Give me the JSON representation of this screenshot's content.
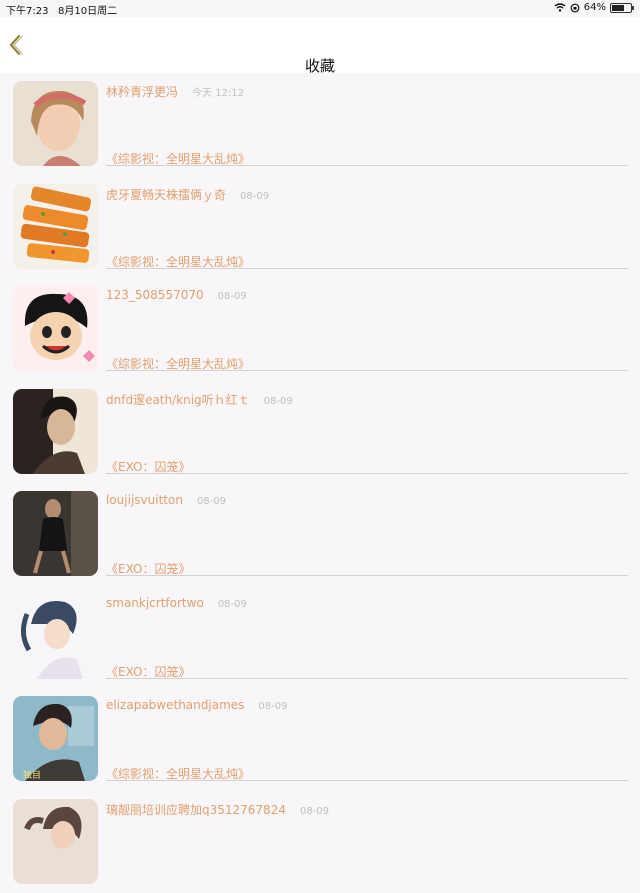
{
  "status": {
    "time": "下午7:23",
    "date": "8月10日周二",
    "battery": "64%",
    "battery_level": 0.64
  },
  "nav": {
    "title": "收藏",
    "back_icon": "chevron-left-icon",
    "back_color": "#8a7a2a"
  },
  "colors": {
    "accent": "#e0a070",
    "muted": "#c0c0c0",
    "background": "#f8f6f8"
  },
  "favorites": [
    {
      "name": "林矜青浮更冯",
      "date": "今天 12:12",
      "title": "《综影视：全明星大乱炖》",
      "avatar": "girl-photo"
    },
    {
      "name": "虎牙夏畅天株擂俩ｙ奇",
      "date": "08-09",
      "title": "《综影视：全明星大乱炖》",
      "avatar": "food-photo"
    },
    {
      "name": "123_508557070",
      "date": "08-09",
      "title": "《综影视：全明星大乱炖》",
      "avatar": "cartoon-photo"
    },
    {
      "name": "dnfd邃eath/knig听ｈ红ｔ",
      "date": "08-09",
      "title": "《EXO：囚笼》",
      "avatar": "man-photo"
    },
    {
      "name": "loujijsvuitton",
      "date": "08-09",
      "title": "《EXO：囚笼》",
      "avatar": "dark-photo"
    },
    {
      "name": "smankjcrtfortwo",
      "date": "08-09",
      "title": "《EXO：囚笼》",
      "avatar": "anime-photo"
    },
    {
      "name": "elizapabwethandjames",
      "date": "08-09",
      "title": "《综影视：全明星大乱炖》",
      "avatar": "boy-photo",
      "avatar_caption": "独目"
    },
    {
      "name": "璃靓丽培训应聘加q3512767824",
      "date": "08-09",
      "title": "",
      "avatar": "woman-photo"
    }
  ]
}
